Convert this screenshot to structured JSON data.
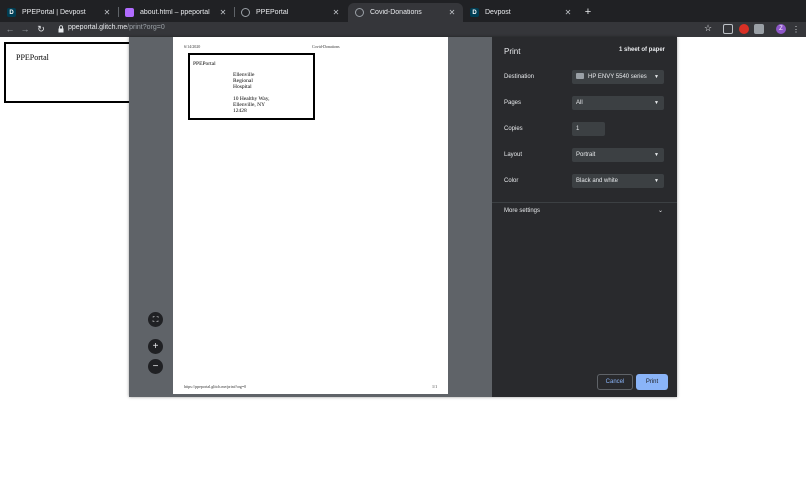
{
  "tabs": [
    {
      "title": "PPEPortal | Devpost",
      "favicon": "D",
      "active": false
    },
    {
      "title": "about.html – ppeportal",
      "favicon": "glitch",
      "active": false
    },
    {
      "title": "PPEPortal",
      "favicon": "globe",
      "active": false
    },
    {
      "title": "Covid-Donations",
      "favicon": "globe",
      "active": true
    },
    {
      "title": "Devpost",
      "favicon": "D",
      "active": false
    }
  ],
  "toolbar": {
    "url_host": "ppeportal.glitch.me",
    "url_path": "/print?org=0",
    "avatar_letter": "Z"
  },
  "page": {
    "brand": "PPEPortal"
  },
  "preview": {
    "header_date": "6/14/2020",
    "header_title": "Covid-Donations",
    "brand": "PPEPortal",
    "address_name": [
      "Ellenville",
      "Regional",
      "Hospital"
    ],
    "address_street": [
      "10 Healthy Way,",
      "Ellenville, NY",
      "12428"
    ],
    "footer_url": "https://ppeportal.glitch.me/print?org=0",
    "footer_page": "1/1"
  },
  "print": {
    "title": "Print",
    "sheets": "1 sheet of paper",
    "destination_label": "Destination",
    "destination_value": "HP ENVY 5540 series",
    "pages_label": "Pages",
    "pages_value": "All",
    "copies_label": "Copies",
    "copies_value": "1",
    "layout_label": "Layout",
    "layout_value": "Portrait",
    "color_label": "Color",
    "color_value": "Black and white",
    "more_settings": "More settings",
    "cancel": "Cancel",
    "print": "Print"
  },
  "colors": {
    "accent": "#8ab4f8",
    "dialog_bg": "#292a2d",
    "preview_bg": "#5f6368"
  }
}
